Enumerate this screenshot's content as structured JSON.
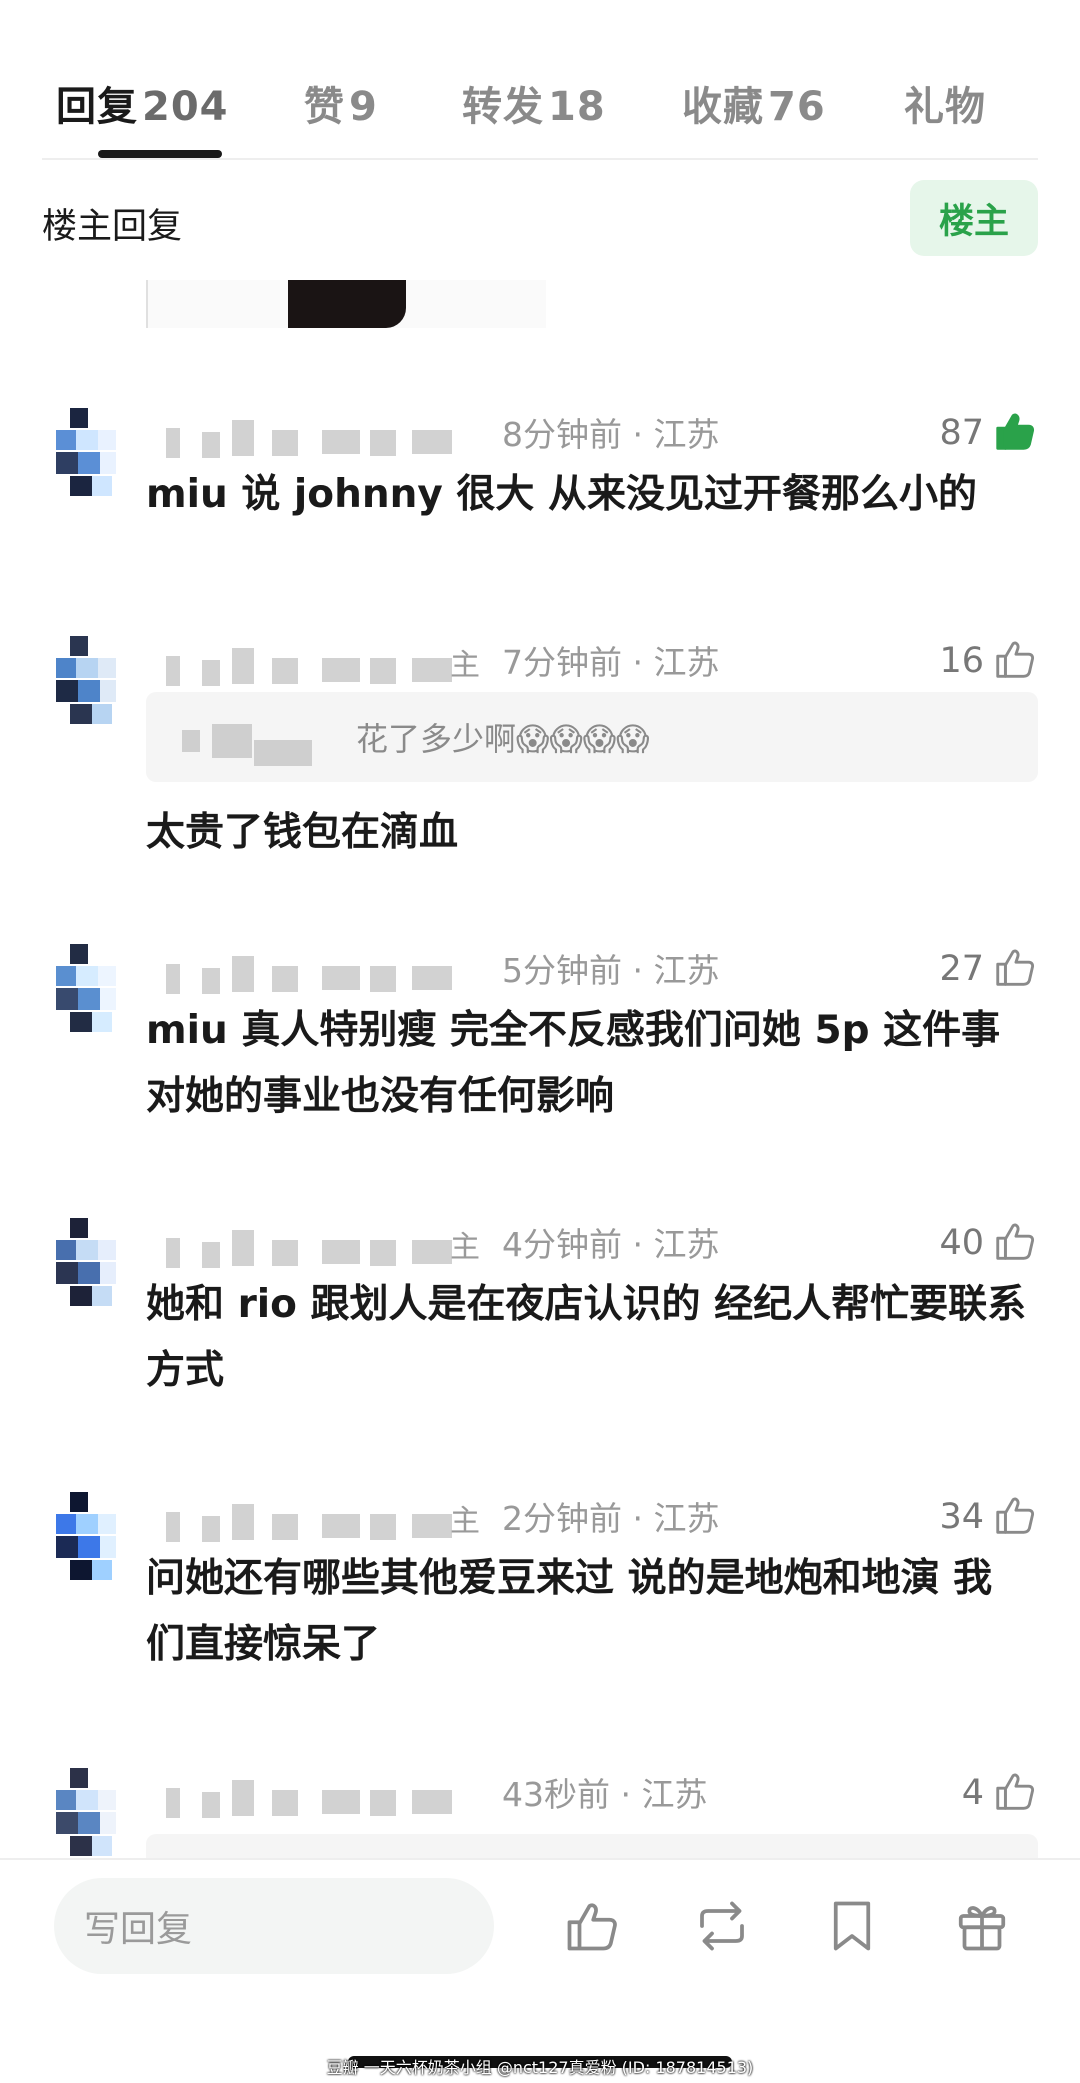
{
  "tabs": [
    {
      "label": "回复",
      "count": "204",
      "active": true
    },
    {
      "label": "赞",
      "count": "9",
      "active": false
    },
    {
      "label": "转发",
      "count": "18",
      "active": false
    },
    {
      "label": "收藏",
      "count": "76",
      "active": false
    },
    {
      "label": "礼物",
      "count": "",
      "active": false
    }
  ],
  "filter": {
    "title": "楼主回复",
    "owner_button": "楼主"
  },
  "comments": [
    {
      "name_tag": "",
      "time": "8分钟前",
      "location": "江苏",
      "likes": "87",
      "liked": true,
      "text": "miu 说 johnny 很大 从来没见过开餐那么小的"
    },
    {
      "name_tag": "主",
      "time": "7分钟前",
      "location": "江苏",
      "likes": "16",
      "liked": false,
      "quote": "花了多少啊😱😱😱😱",
      "text": "太贵了钱包在滴血"
    },
    {
      "name_tag": "",
      "time": "5分钟前",
      "location": "江苏",
      "likes": "27",
      "liked": false,
      "text": "miu 真人特别瘦 完全不反感我们问她 5p 这件事 对她的事业也没有任何影响"
    },
    {
      "name_tag": "主",
      "time": "4分钟前",
      "location": "江苏",
      "likes": "40",
      "liked": false,
      "text": "她和 rio 跟划人是在夜店认识的 经纪人帮忙要联系方式"
    },
    {
      "name_tag": "主",
      "time": "2分钟前",
      "location": "江苏",
      "likes": "34",
      "liked": false,
      "text": "问她还有哪些其他爱豆来过 说的是地炮和地演 我们直接惊呆了"
    },
    {
      "name_tag": "",
      "time": "43秒前",
      "location": "江苏",
      "likes": "4",
      "liked": false,
      "text": ""
    }
  ],
  "bottom_bar": {
    "reply_placeholder": "写回复",
    "icons": [
      "like-icon",
      "repost-icon",
      "bookmark-icon",
      "gift-icon"
    ]
  },
  "watermark": "豆瓣 一天六杯奶茶小组 @nct127真爱粉 (ID: 187814513)",
  "colors": {
    "accent_green": "#2aa24a",
    "owner_bg": "#e6f6ea",
    "text_gray": "#999999"
  }
}
